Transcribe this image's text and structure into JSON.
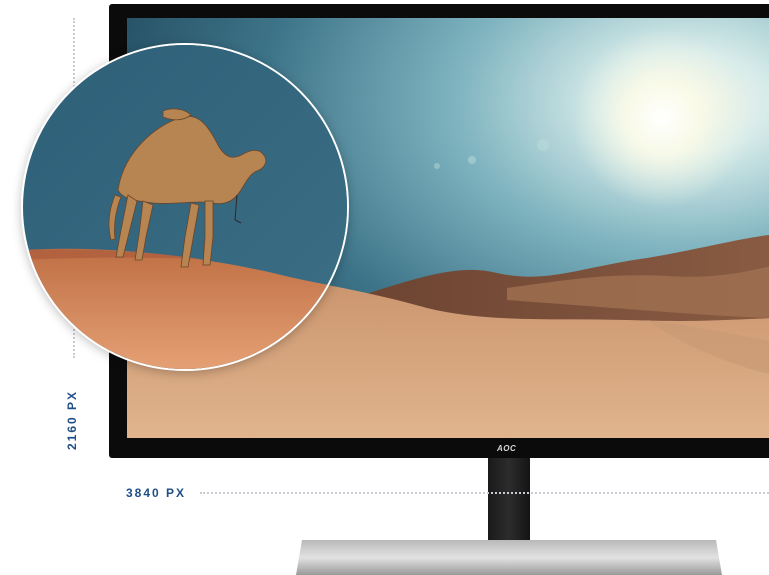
{
  "labels": {
    "height_label": "2160 PX",
    "width_label": "3840 PX"
  },
  "monitor": {
    "brand_logo": "AOC"
  },
  "colors": {
    "label_blue": "#1e4e86",
    "sky_top": "#1f4a5e",
    "sky_bright": "#cfe7ea",
    "sand": "#c98a58",
    "bezel": "#0b0b0b"
  }
}
